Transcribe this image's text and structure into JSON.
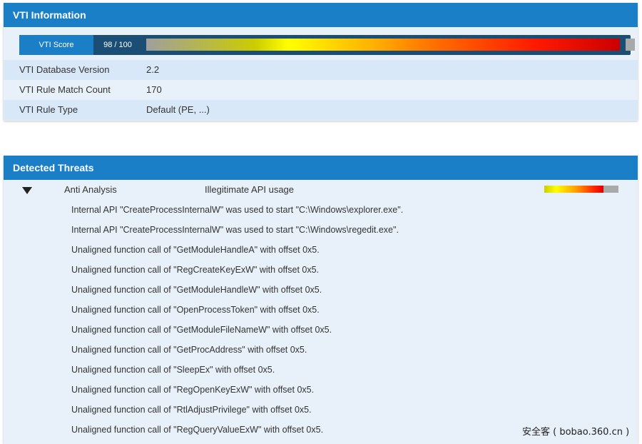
{
  "vti_panel": {
    "title": "VTI Information",
    "score_label": "VTI Score",
    "score_value": "98 / 100",
    "score_fraction": 0.98,
    "rows": [
      {
        "key": "VTI Database Version",
        "value": "2.2"
      },
      {
        "key": "VTI Rule Match Count",
        "value": "170"
      },
      {
        "key": "VTI Rule Type",
        "value": "Default (PE, ...)"
      }
    ]
  },
  "threats_panel": {
    "title": "Detected Threats",
    "threat": {
      "category": "Anti Analysis",
      "name": "Illegitimate API usage",
      "severity_fraction": 0.8,
      "details": [
        "Internal API \"CreateProcessInternalW\" was used to start \"C:\\Windows\\explorer.exe\".",
        "Internal API \"CreateProcessInternalW\" was used to start \"C:\\Windows\\regedit.exe\".",
        "Unaligned function call of \"GetModuleHandleA\" with offset 0x5.",
        "Unaligned function call of \"RegCreateKeyExW\" with offset 0x5.",
        "Unaligned function call of \"GetModuleHandleW\" with offset 0x5.",
        "Unaligned function call of \"OpenProcessToken\" with offset 0x5.",
        "Unaligned function call of \"GetModuleFileNameW\" with offset 0x5.",
        "Unaligned function call of \"GetProcAddress\" with offset 0x5.",
        "Unaligned function call of \"SleepEx\" with offset 0x5.",
        "Unaligned function call of \"RegOpenKeyExW\" with offset 0x5.",
        "Unaligned function call of \"RtlAdjustPrivilege\" with offset 0x5.",
        "Unaligned function call of \"RegQueryValueExW\" with offset 0x5."
      ]
    }
  },
  "watermark": "安全客 ( bobao.360.cn )"
}
